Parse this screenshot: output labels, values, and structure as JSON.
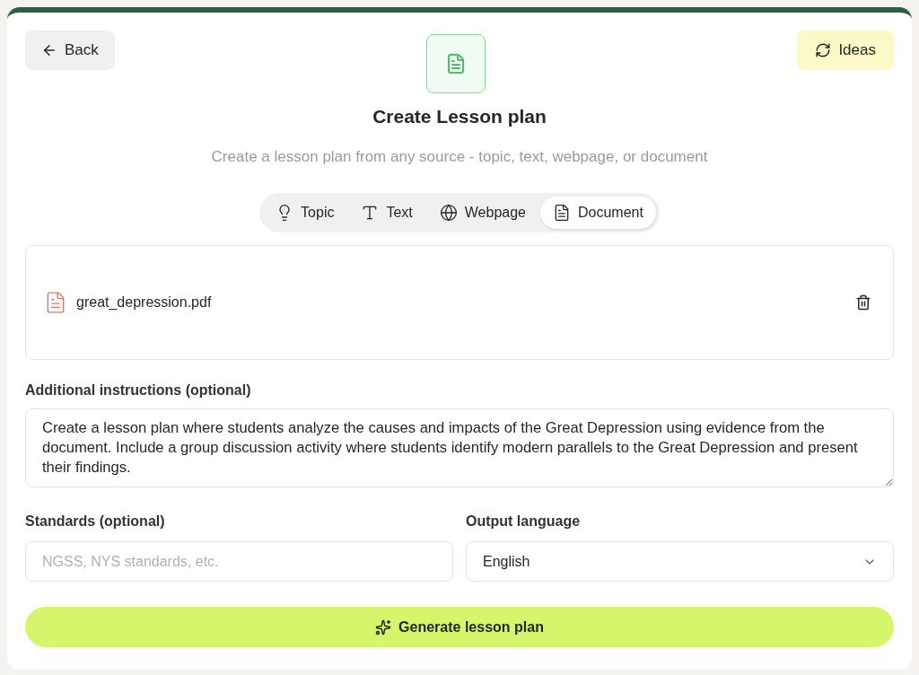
{
  "header": {
    "back": "Back",
    "ideas": "Ideas",
    "title": "Create Lesson plan",
    "subtitle": "Create a lesson plan from any source - topic, text, webpage, or document"
  },
  "tabs": [
    {
      "kind": "topic",
      "label": "Topic",
      "selected": false
    },
    {
      "kind": "text",
      "label": "Text",
      "selected": false
    },
    {
      "kind": "webpage",
      "label": "Webpage",
      "selected": false
    },
    {
      "kind": "document",
      "label": "Document",
      "selected": true
    }
  ],
  "file": {
    "name": "great_depression.pdf"
  },
  "instructions": {
    "label": "Additional instructions (optional)",
    "value": "Create a lesson plan where students analyze the causes and impacts of the Great Depression using evidence from the document. Include a group discussion activity where students identify modern parallels to the Great Depression and present their findings."
  },
  "standards": {
    "label": "Standards (optional)",
    "placeholder": "NGSS, NYS standards, etc."
  },
  "language": {
    "label": "Output language",
    "value": "English"
  },
  "generate": "Generate lesson plan"
}
